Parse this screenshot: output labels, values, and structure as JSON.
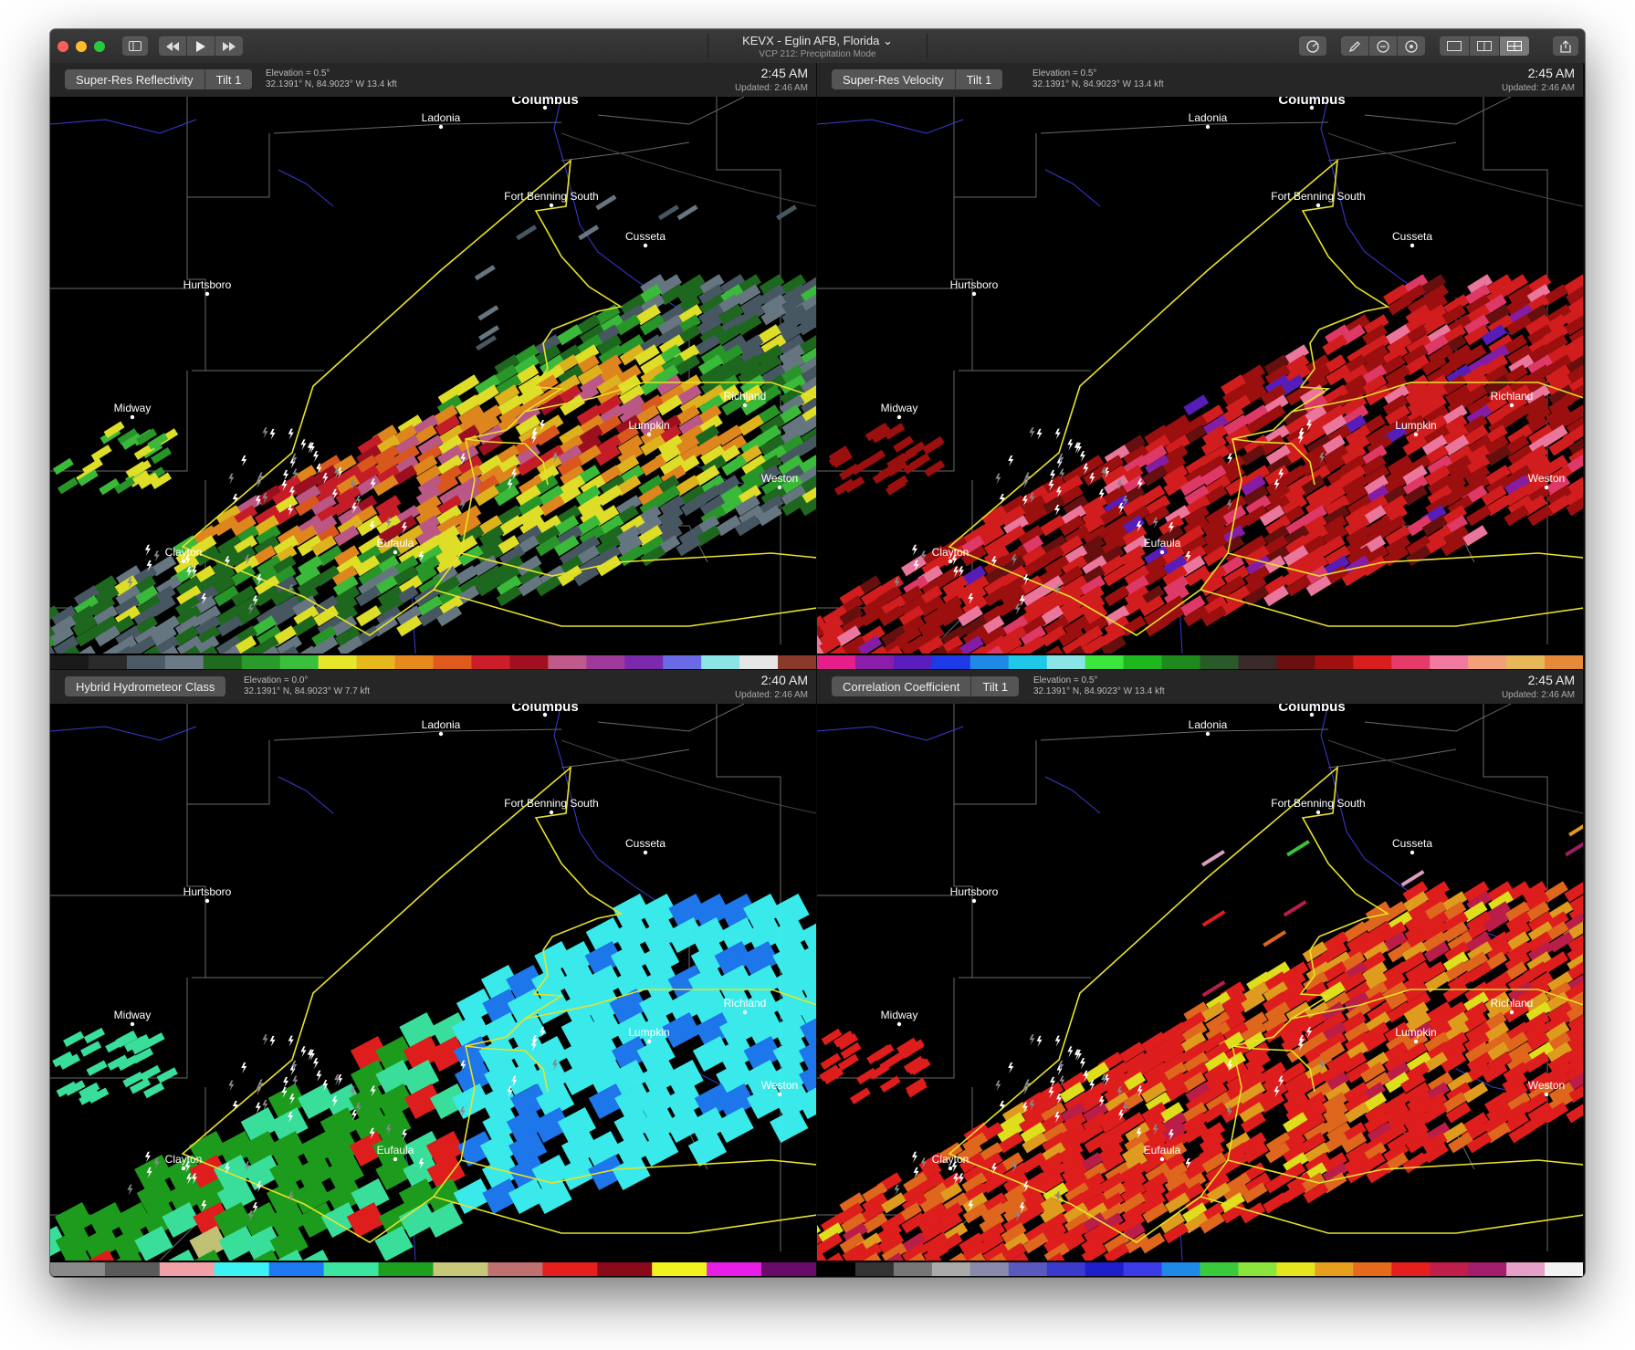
{
  "window": {
    "title": "KEVX - Eglin AFB, Florida",
    "title_caret": "⌄",
    "subtitle": "VCP 212: Precipitation Mode"
  },
  "toolbar": {
    "left_icons": [
      "sidebar-icon",
      "rewind-icon",
      "play-icon",
      "fast-forward-icon"
    ],
    "right_icons": [
      "sweep-icon",
      "pencil-icon",
      "minus-circle-icon",
      "target-icon",
      "single-layout-icon",
      "dual-layout-icon",
      "quad-layout-icon",
      "share-icon"
    ]
  },
  "colors": {
    "background": "#000000",
    "boundary": "#e8e22a",
    "county_line": "#6a6a6a",
    "river": "#3b3bd6",
    "label": "#ffffff"
  },
  "panels": [
    {
      "product": "Super-Res Reflectivity",
      "tilt": "Tilt 1",
      "elevation": "Elevation = 0.5°",
      "location": "32.1391° N, 84.9023° W 13.4 kft",
      "time": "2:45 AM",
      "updated": "Updated: 2:46 AM"
    },
    {
      "product": "Super-Res Velocity",
      "tilt": "Tilt 1",
      "elevation": "Elevation = 0.5°",
      "location": "32.1391° N, 84.9023° W 13.4 kft",
      "time": "2:45 AM",
      "updated": "Updated: 2:46 AM"
    },
    {
      "product": "Hybrid Hydrometeor Class",
      "tilt": "",
      "elevation": "Elevation = 0.0°",
      "location": "32.1391° N, 84.9023° W 7.7 kft",
      "time": "2:40 AM",
      "updated": "Updated: 2:46 AM"
    },
    {
      "product": "Correlation Coefficient",
      "tilt": "Tilt 1",
      "elevation": "Elevation = 0.5°",
      "location": "32.1391° N, 84.9023° W 13.4 kft",
      "time": "2:45 AM",
      "updated": "Updated: 2:46 AM"
    }
  ],
  "cities": [
    "Columbus",
    "Ladonia",
    "Fort Benning South",
    "Cusseta",
    "Hurtsboro",
    "Midway",
    "Richland",
    "Lumpkin",
    "Weston",
    "Eufaula",
    "Clayton"
  ],
  "palettes": {
    "reflectivity": [
      "#1a1a1a",
      "#2a2a2a",
      "#4a5a66",
      "#6a7a86",
      "#1f6b1f",
      "#2a9a2a",
      "#3cbf3c",
      "#e6e62a",
      "#e6b81e",
      "#e68a1e",
      "#e05a1e",
      "#cc1e2a",
      "#a01020",
      "#c05a8a",
      "#a03a9a",
      "#7a2aaa",
      "#6a6ae6",
      "#8ae6e6",
      "#e6e6e6",
      "#8a3a2a"
    ],
    "velocity": [
      "#e61e8a",
      "#8a1eaa",
      "#5a1ebe",
      "#1e3ae6",
      "#1e8ae6",
      "#1ec8e6",
      "#8ae6e6",
      "#3ce63c",
      "#1eb81e",
      "#1e8a1e",
      "#2a5a2a",
      "#3a2a2a",
      "#6a1010",
      "#a01010",
      "#d81e1e",
      "#e63a6a",
      "#f27aa0",
      "#f2a07a",
      "#e6b85a",
      "#e68a3a"
    ],
    "hydrometeor": [
      "#8a8a8a",
      "#5a5a5a",
      "#f2a0a8",
      "#3cf2f2",
      "#1e7af2",
      "#3ce6a0",
      "#1ea01e",
      "#c8c87a",
      "#c07070",
      "#e61e1e",
      "#8a0a1a",
      "#f2f21e",
      "#e61ee6",
      "#6a0a6a"
    ],
    "correlation": [
      "#000000",
      "#333333",
      "#777777",
      "#aaaaaa",
      "#8a8aaa",
      "#5a5abe",
      "#3a3acc",
      "#1e1ecc",
      "#3a3ae6",
      "#1e8ae6",
      "#3cc83c",
      "#8ae63c",
      "#e6e61e",
      "#e6a01e",
      "#e66a1e",
      "#e61e1e",
      "#c01e4a",
      "#a01e6a",
      "#e6a0c8",
      "#f2f2f2"
    ]
  }
}
